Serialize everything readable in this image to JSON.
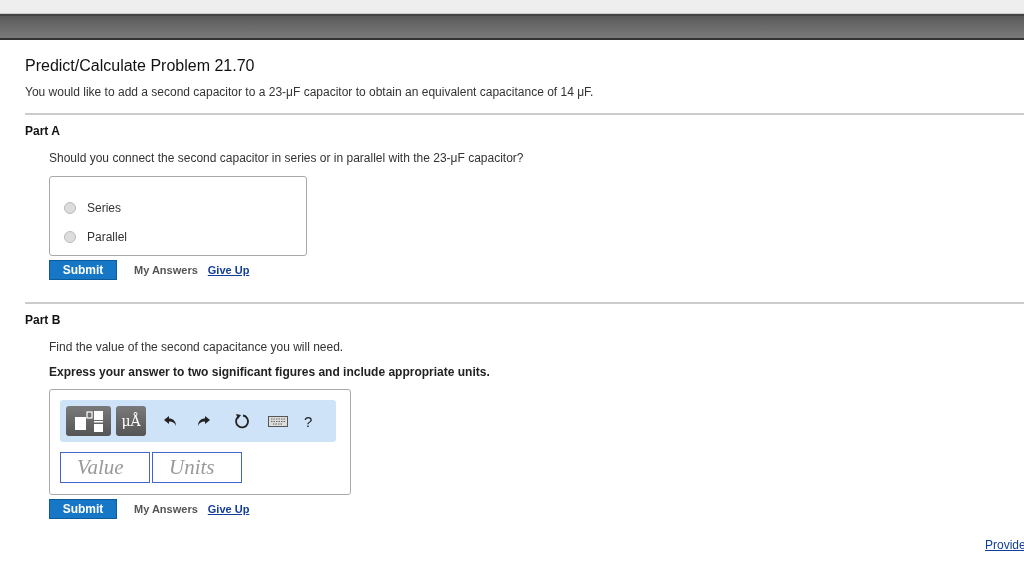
{
  "title": "Predict/Calculate Problem 21.70",
  "intro": "You would like to add a second capacitor to a 23-μF capacitor to obtain an equivalent capacitance of 14 μF.",
  "part_a": {
    "heading": "Part A",
    "question": "Should you connect the second capacitor in series or in parallel with the 23-μF capacitor?",
    "options": [
      {
        "label": "Series",
        "selected": false
      },
      {
        "label": "Parallel",
        "selected": false
      }
    ],
    "submit": "Submit",
    "my_answers": "My Answers",
    "give_up": "Give Up"
  },
  "part_b": {
    "heading": "Part B",
    "question": "Find the value of the second capacitance you will need.",
    "instruction": "Express your answer to two significant figures and include appropriate units.",
    "toolbar": {
      "units_button": "μÅ",
      "help": "?"
    },
    "value_field": {
      "placeholder": "Value"
    },
    "units_field": {
      "placeholder": "Units"
    },
    "submit": "Submit",
    "my_answers": "My Answers",
    "give_up": "Give Up"
  },
  "footer_link": "Provide"
}
